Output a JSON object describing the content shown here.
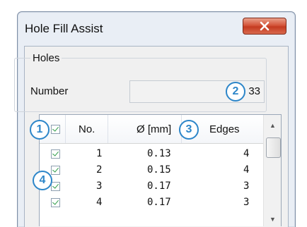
{
  "window": {
    "title": "Hole Fill Assist"
  },
  "holes_group": {
    "legend": "Holes",
    "number_label": "Number",
    "number_value": "33"
  },
  "table": {
    "headers": {
      "no": "No.",
      "diameter": "Ø [mm]",
      "edges": "Edges"
    },
    "rows": [
      {
        "no": "1",
        "diameter": "0.13",
        "edges": "4",
        "checked": true
      },
      {
        "no": "2",
        "diameter": "0.15",
        "edges": "4",
        "checked": true
      },
      {
        "no": "3",
        "diameter": "0.17",
        "edges": "3",
        "checked": true
      },
      {
        "no": "4",
        "diameter": "0.17",
        "edges": "3",
        "checked": true
      }
    ]
  },
  "callouts": [
    "1",
    "2",
    "3",
    "4"
  ],
  "colors": {
    "callout": "#2d86c9",
    "close_button": "#c43b21",
    "check": "#2e9c48"
  },
  "icons": {
    "close": "close-icon",
    "scroll_up": "scroll-up-arrow-icon",
    "scroll_down": "scroll-down-arrow-icon"
  }
}
